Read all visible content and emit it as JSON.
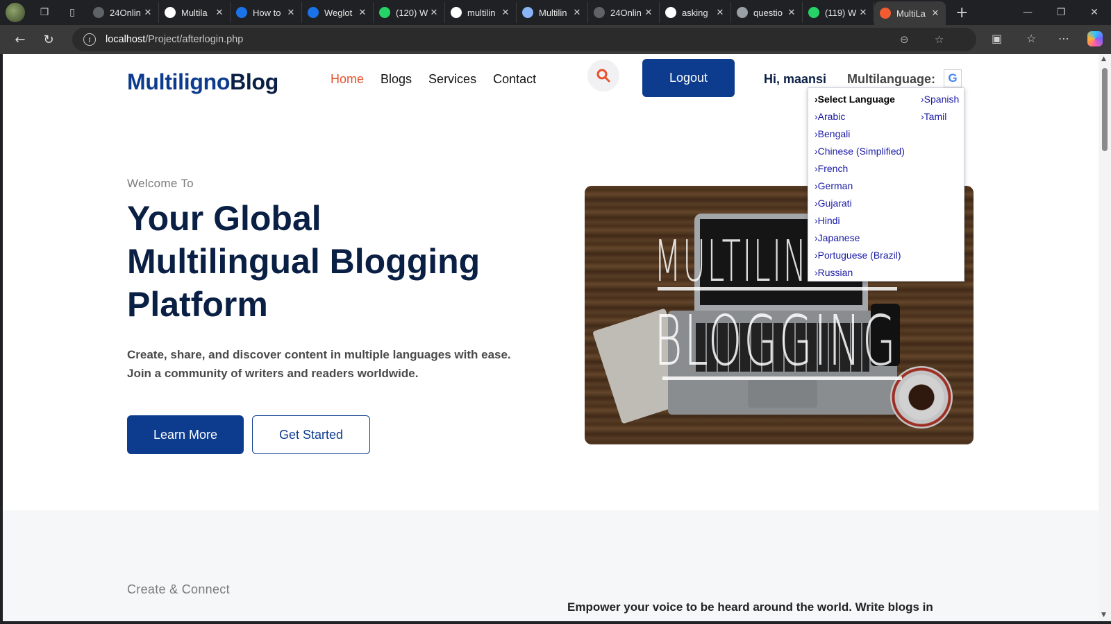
{
  "browser": {
    "tabs": [
      {
        "label": "24Onlin",
        "favicon_color": "#5f6368"
      },
      {
        "label": "Multila",
        "favicon_color": "#ffffff"
      },
      {
        "label": "How to",
        "favicon_color": "#1a73e8"
      },
      {
        "label": "Weglot",
        "favicon_color": "#1a73e8"
      },
      {
        "label": "(120) W",
        "favicon_color": "#25d366"
      },
      {
        "label": "multilin",
        "favicon_color": "#ffffff"
      },
      {
        "label": "Multilin",
        "favicon_color": "#8ab4f8"
      },
      {
        "label": "24Onlin",
        "favicon_color": "#5f6368"
      },
      {
        "label": "asking",
        "favicon_color": "#ffffff"
      },
      {
        "label": "questio",
        "favicon_color": "#9aa0a6"
      },
      {
        "label": "(119) W",
        "favicon_color": "#25d366"
      },
      {
        "label": "MultiLa",
        "favicon_color": "#f25c30"
      }
    ],
    "url_host": "localhost",
    "url_path": "/Project/afterlogin.php"
  },
  "header": {
    "brand_part1": "Multiligno",
    "brand_part2": "Blog",
    "nav": [
      "Home",
      "Blogs",
      "Services",
      "Contact"
    ],
    "logout_label": "Logout",
    "greeting": "Hi, maansi",
    "multilanguage_label": "Multilanguage:",
    "google_icon_letter": "G"
  },
  "language_menu": {
    "column1": [
      "›Select Language",
      "›Arabic",
      "›Bengali",
      "›Chinese (Simplified)",
      "›French",
      "›German",
      "›Gujarati",
      "›Hindi",
      "›Japanese",
      "›Portuguese (Brazil)",
      "›Russian"
    ],
    "column2": [
      "›Spanish",
      "›Tamil"
    ]
  },
  "hero": {
    "welcome": "Welcome To",
    "headline_bold": "Your",
    "headline_rest1": " Global",
    "headline_line2": "Multilingual Blogging",
    "headline_line3": "Platform",
    "description": "Create, share, and discover content in multiple languages with ease. Join a community of writers and readers worldwide.",
    "learn_more": "Learn More",
    "get_started": "Get Started",
    "image_text_line1": "MULTILINGUAL",
    "image_text_line2": "BLOGGING"
  },
  "section2": {
    "title": "Create & Connect",
    "text": "Empower your voice to be heard around the world. Write blogs in"
  },
  "colors": {
    "primary": "#0d3b8e",
    "nav_active": "#e8502d",
    "heading": "#0a1f44"
  }
}
